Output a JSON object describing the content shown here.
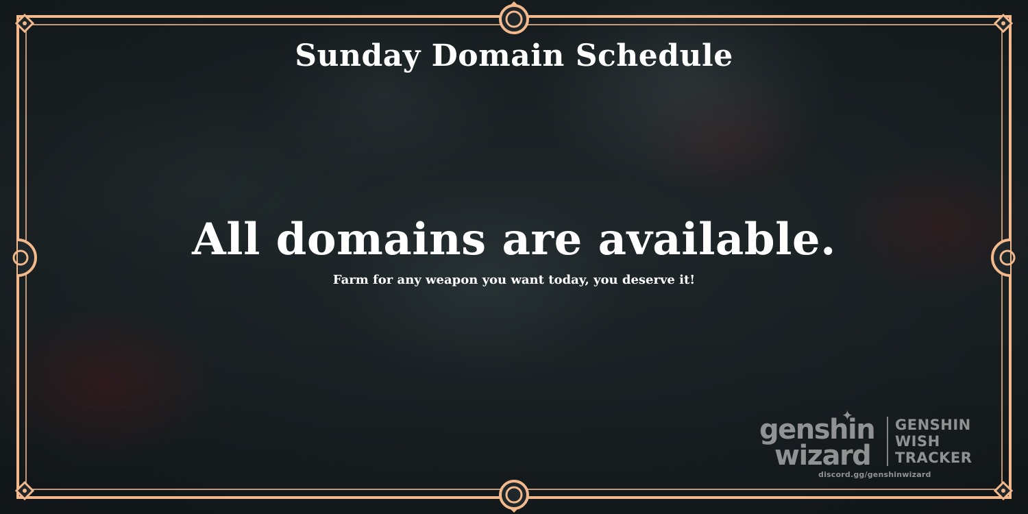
{
  "title": "Sunday Domain Schedule",
  "headline": "All domains are available.",
  "subtitle": "Farm for any weapon you want today, you deserve it!",
  "brand": {
    "word1": "genshin",
    "word2": "wizard",
    "line1": "GENSHIN",
    "line2": "WISH",
    "line3": "TRACKER",
    "url": "discord.gg/genshinwizard"
  },
  "colors": {
    "frame": "#f3b98c",
    "text": "#ffffff"
  },
  "icons": {
    "sparkle": "sparkle-icon"
  }
}
